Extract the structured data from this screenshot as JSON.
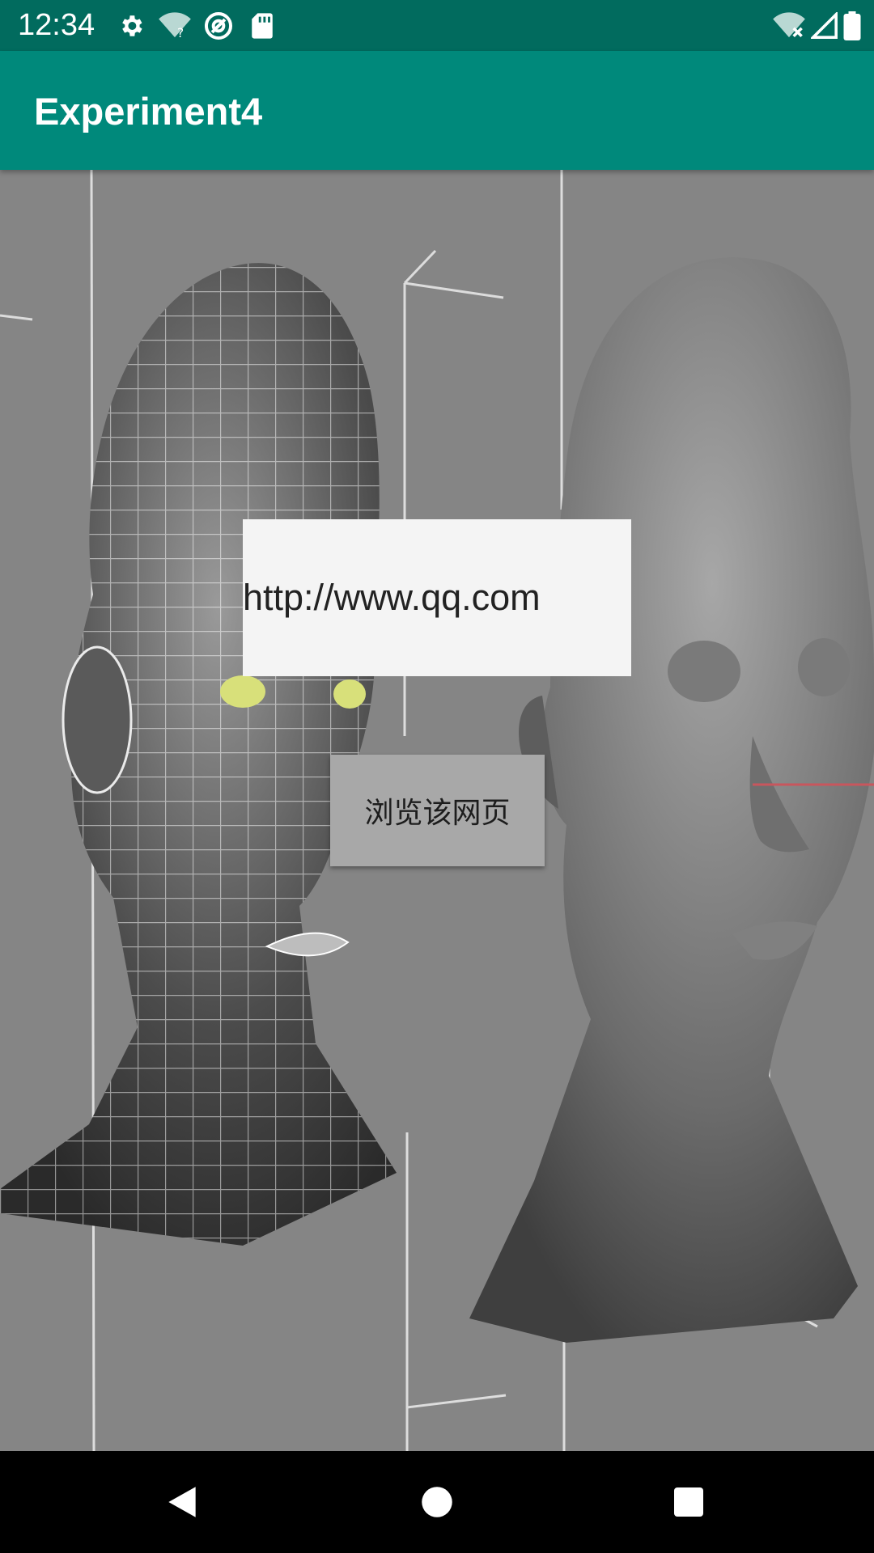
{
  "status_bar": {
    "time": "12:34",
    "icons_left": [
      "gear-icon",
      "wifi-question-icon",
      "at-sign-icon",
      "sd-card-icon"
    ],
    "icons_right": [
      "wifi-off-icon",
      "cell-signal-icon",
      "battery-icon"
    ],
    "background": "#016b5e"
  },
  "app_bar": {
    "title": "Experiment4",
    "background": "#00897b"
  },
  "main": {
    "url_input_value": "http://www.qq.com",
    "browse_button_label": "浏览该网页",
    "background_image": "3d-head-wireframe-and-render"
  },
  "nav_bar": {
    "buttons": [
      "back-icon",
      "home-icon",
      "recents-icon"
    ]
  }
}
